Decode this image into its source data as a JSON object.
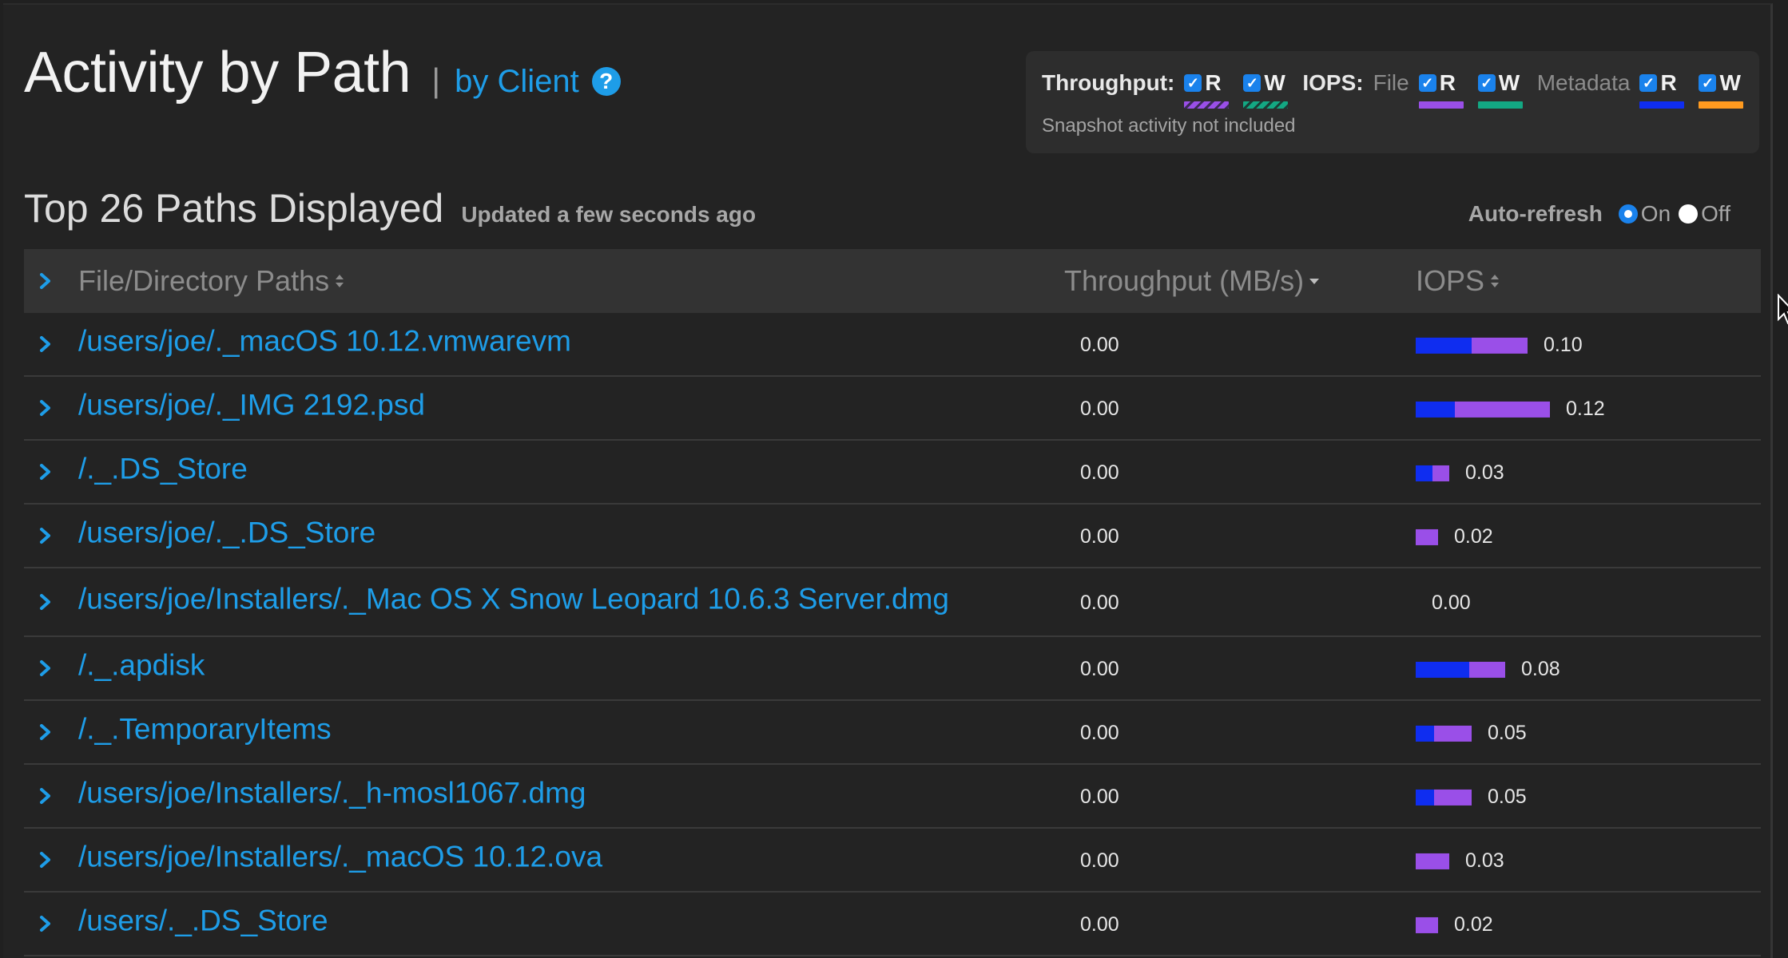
{
  "header": {
    "title": "Activity by Path",
    "separator": "|",
    "by_client": "by Client",
    "help": "?"
  },
  "legend": {
    "throughput_label": "Throughput:",
    "iops_label": "IOPS:",
    "file_label": "File",
    "metadata_label": "Metadata",
    "note": "Snapshot activity not included",
    "items": [
      {
        "group": "throughput",
        "letter": "R",
        "checked": true,
        "color": "#9a4fe8"
      },
      {
        "group": "throughput",
        "letter": "W",
        "checked": true,
        "color": "#13a883"
      },
      {
        "group": "file",
        "letter": "R",
        "checked": true,
        "color": "#9a4fe8"
      },
      {
        "group": "file",
        "letter": "W",
        "checked": true,
        "color": "#13a883"
      },
      {
        "group": "metadata",
        "letter": "R",
        "checked": true,
        "color": "#0f2df0"
      },
      {
        "group": "metadata",
        "letter": "W",
        "checked": true,
        "color": "#ff9a1f"
      }
    ]
  },
  "summary": {
    "title": "Top 26 Paths Displayed",
    "updated": "Updated a few seconds ago"
  },
  "auto_refresh": {
    "label": "Auto-refresh",
    "on": "On",
    "off": "Off",
    "selected": "On"
  },
  "table": {
    "columns": {
      "path": "File/Directory Paths",
      "throughput": "Throughput (MB/s)",
      "iops": "IOPS"
    },
    "rows": [
      {
        "path": "/users/joe/._macOS 10.12.vmwarevm",
        "throughput": "0.00",
        "iops": "0.10",
        "iops_value": 0.1,
        "metadata_read_fraction": 0.5
      },
      {
        "path": "/users/joe/._IMG 2192.psd",
        "throughput": "0.00",
        "iops": "0.12",
        "iops_value": 0.12,
        "metadata_read_fraction": 0.29
      },
      {
        "path": "/._.DS_Store",
        "throughput": "0.00",
        "iops": "0.03",
        "iops_value": 0.03,
        "metadata_read_fraction": 0.5
      },
      {
        "path": "/users/joe/._.DS_Store",
        "throughput": "0.00",
        "iops": "0.02",
        "iops_value": 0.02,
        "metadata_read_fraction": 0.0
      },
      {
        "path": "/users/joe/Installers/._Mac OS X Snow Leopard 10.6.3 Server.dmg",
        "throughput": "0.00",
        "iops": "0.00",
        "iops_value": 0.0,
        "metadata_read_fraction": 0.0
      },
      {
        "path": "/._.apdisk",
        "throughput": "0.00",
        "iops": "0.08",
        "iops_value": 0.08,
        "metadata_read_fraction": 0.6
      },
      {
        "path": "/._.TemporaryItems",
        "throughput": "0.00",
        "iops": "0.05",
        "iops_value": 0.05,
        "metadata_read_fraction": 0.33
      },
      {
        "path": "/users/joe/Installers/._h-mosl1067.dmg",
        "throughput": "0.00",
        "iops": "0.05",
        "iops_value": 0.05,
        "metadata_read_fraction": 0.33
      },
      {
        "path": "/users/joe/Installers/._macOS 10.12.ova",
        "throughput": "0.00",
        "iops": "0.03",
        "iops_value": 0.03,
        "metadata_read_fraction": 0.0
      },
      {
        "path": "/users/._.DS_Store",
        "throughput": "0.00",
        "iops": "0.02",
        "iops_value": 0.02,
        "metadata_read_fraction": 0.0
      }
    ]
  },
  "icons": {
    "expand": "chevron-right-icon",
    "help": "question-circle-icon",
    "sort": "sort-icon",
    "sort_desc": "caret-down-icon",
    "cursor": "mouse-pointer-icon"
  }
}
